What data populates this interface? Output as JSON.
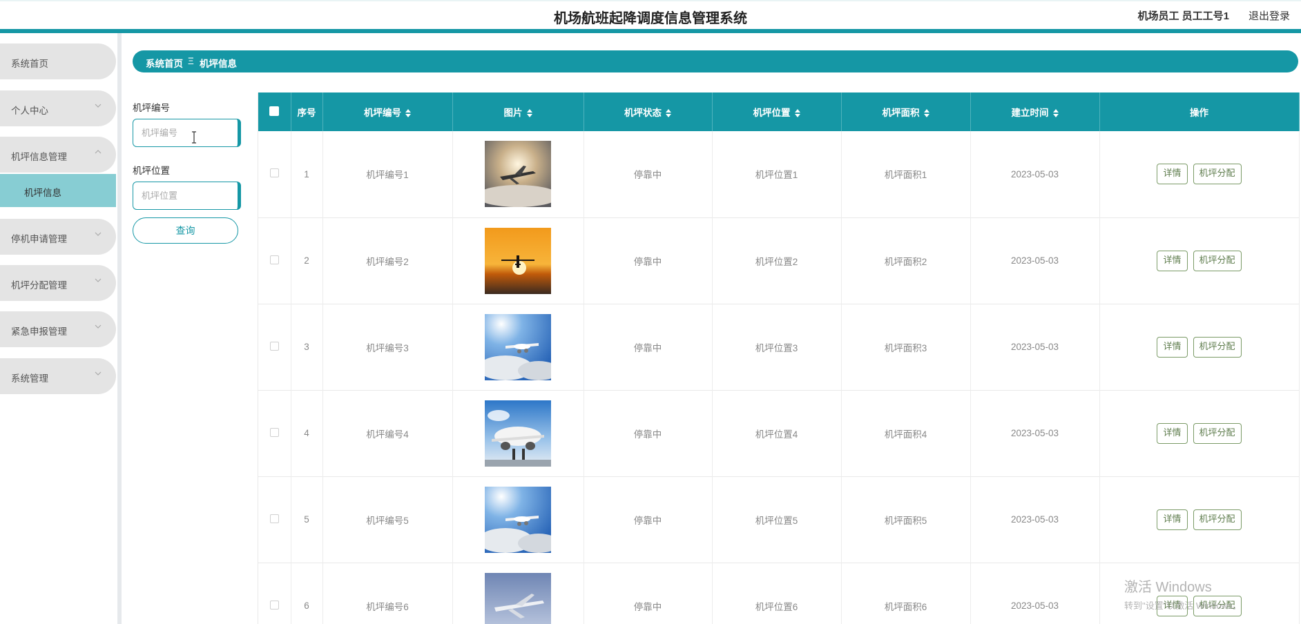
{
  "header": {
    "title": "机场航班起降调度信息管理系统",
    "user": "机场员工 员工工号1",
    "logout": "退出登录"
  },
  "sidebar": {
    "items": [
      {
        "label": "系统首页",
        "has_children": false
      },
      {
        "label": "个人中心",
        "has_children": true,
        "expanded": false
      },
      {
        "label": "机坪信息管理",
        "has_children": true,
        "expanded": true
      },
      {
        "label": "停机申请管理",
        "has_children": true,
        "expanded": false
      },
      {
        "label": "机坪分配管理",
        "has_children": true,
        "expanded": false
      },
      {
        "label": "紧急申报管理",
        "has_children": true,
        "expanded": false
      },
      {
        "label": "系统管理",
        "has_children": true,
        "expanded": false
      }
    ],
    "submenu_active": "机坪信息"
  },
  "breadcrumb": {
    "home": "系统首页",
    "separator": "Ξ",
    "current": "机坪信息"
  },
  "search": {
    "field1_label": "机坪编号",
    "field1_placeholder": "机坪编号",
    "field2_label": "机坪位置",
    "field2_placeholder": "机坪位置",
    "button": "查询"
  },
  "table": {
    "columns": [
      "序号",
      "机坪编号",
      "图片",
      "机坪状态",
      "机坪位置",
      "机坪面积",
      "建立时间",
      "操作"
    ],
    "rows": [
      {
        "index": "1",
        "code": "机坪编号1",
        "image": "plane-in-clouds-sunlit",
        "status": "停靠中",
        "location": "机坪位置1",
        "area": "机坪面积1",
        "date": "2023-05-03"
      },
      {
        "index": "2",
        "code": "机坪编号2",
        "image": "plane-landing-sunset",
        "status": "停靠中",
        "location": "机坪位置2",
        "area": "机坪面积2",
        "date": "2023-05-03"
      },
      {
        "index": "3",
        "code": "机坪编号3",
        "image": "plane-blue-sky",
        "status": "停靠中",
        "location": "机坪位置3",
        "area": "机坪面积3",
        "date": "2023-05-03"
      },
      {
        "index": "4",
        "code": "机坪编号4",
        "image": "plane-front-view",
        "status": "停靠中",
        "location": "机坪位置4",
        "area": "机坪面积4",
        "date": "2023-05-03"
      },
      {
        "index": "5",
        "code": "机坪编号5",
        "image": "plane-blue-sky",
        "status": "停靠中",
        "location": "机坪位置5",
        "area": "机坪面积5",
        "date": "2023-05-03"
      },
      {
        "index": "6",
        "code": "机坪编号6",
        "image": "plane-grey-sky",
        "status": "停靠中",
        "location": "机坪位置6",
        "area": "机坪面积6",
        "date": "2023-05-03"
      }
    ],
    "action_detail": "详情",
    "action_assign": "机坪分配"
  },
  "watermark": {
    "line1": "激活 Windows",
    "line2": "转到\"设置\"以激活 Windows。"
  },
  "colors": {
    "accent": "#1597a5",
    "submenu_active": "#87cdd3",
    "menu_bg": "#e4e4e4",
    "action_border": "#7a9a66"
  }
}
